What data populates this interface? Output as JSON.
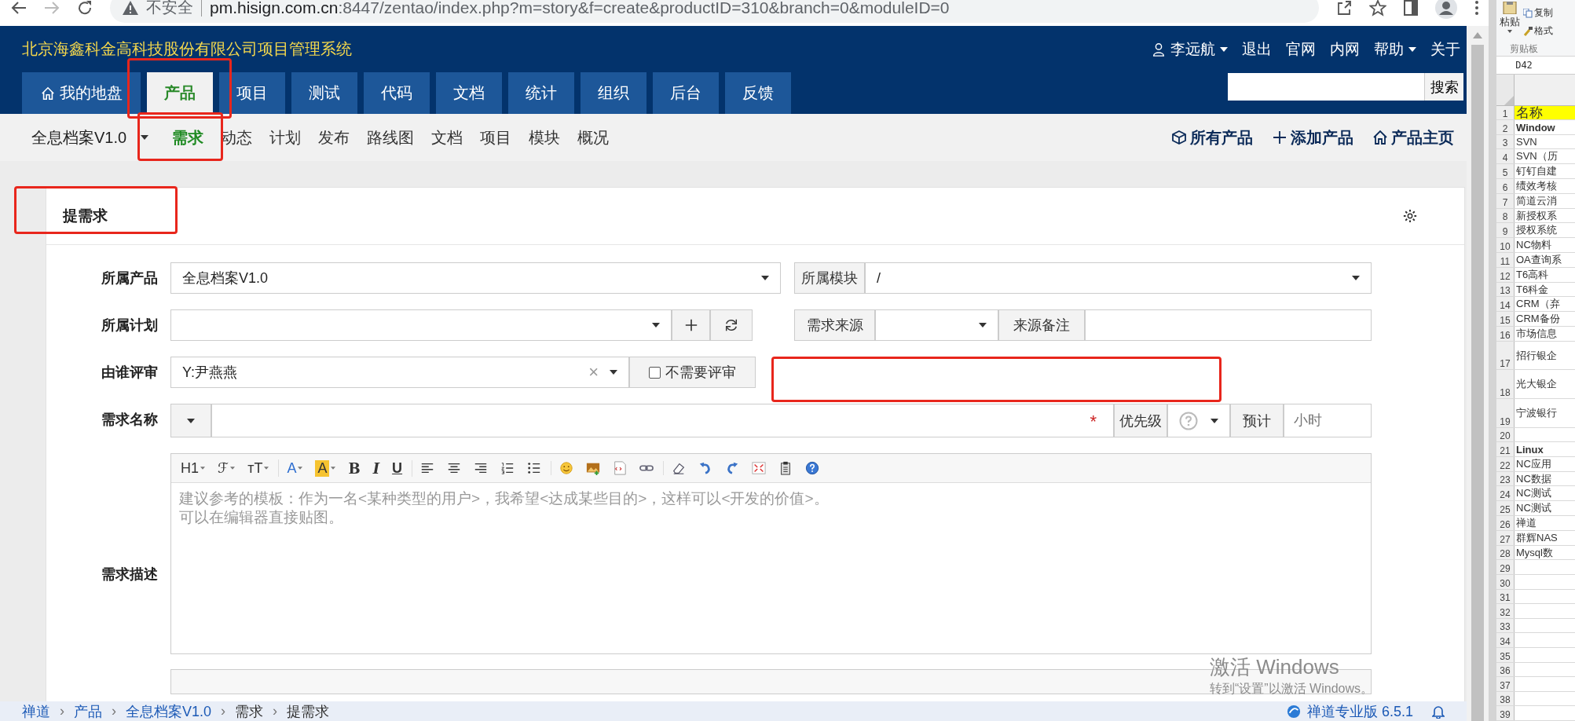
{
  "browser": {
    "security": "不安全",
    "url_host": "pm.hisign.com.cn",
    "url_rest": ":8447/zentao/index.php?m=story&f=create&productID=310&branch=0&moduleID=0"
  },
  "header": {
    "title": "北京海鑫科金高科技股份有限公司项目管理系统",
    "user": {
      "label": "李远航",
      "dropdown": true
    },
    "links": [
      {
        "label": "退出",
        "dropdown": false
      },
      {
        "label": "官网",
        "dropdown": false
      },
      {
        "label": "内网",
        "dropdown": false
      },
      {
        "label": "帮助",
        "dropdown": true
      },
      {
        "label": "关于",
        "dropdown": false
      }
    ],
    "search": {
      "button": "搜索"
    }
  },
  "nav": [
    {
      "label": "我的地盘",
      "selected": false
    },
    {
      "label": "产品",
      "selected": true
    },
    {
      "label": "项目",
      "selected": false
    },
    {
      "label": "测试",
      "selected": false
    },
    {
      "label": "代码",
      "selected": false
    },
    {
      "label": "文档",
      "selected": false
    },
    {
      "label": "统计",
      "selected": false
    },
    {
      "label": "组织",
      "selected": false
    },
    {
      "label": "后台",
      "selected": false
    },
    {
      "label": "反馈",
      "selected": false
    }
  ],
  "subnav": {
    "product": "全息档案V1.0",
    "items": [
      {
        "label": "需求",
        "selected": true
      },
      {
        "label": "动态",
        "selected": false
      },
      {
        "label": "计划",
        "selected": false
      },
      {
        "label": "发布",
        "selected": false
      },
      {
        "label": "路线图",
        "selected": false
      },
      {
        "label": "文档",
        "selected": false
      },
      {
        "label": "项目",
        "selected": false
      },
      {
        "label": "模块",
        "selected": false
      },
      {
        "label": "概况",
        "selected": false
      }
    ],
    "actions": [
      {
        "label": "所有产品"
      },
      {
        "label": "添加产品"
      },
      {
        "label": "产品主页"
      }
    ]
  },
  "panel": {
    "title": "提需求"
  },
  "form": {
    "product": {
      "label": "所属产品",
      "value": "全息档案V1.0"
    },
    "module": {
      "label": "所属模块",
      "value": "/"
    },
    "plan": {
      "label": "所属计划"
    },
    "source": {
      "label": "需求来源"
    },
    "source_note": {
      "label": "来源备注"
    },
    "reviewer": {
      "label": "由谁评审",
      "value": "Y:尹燕燕",
      "clear": "×"
    },
    "no_review": {
      "label": "不需要评审",
      "checked": false
    },
    "title": {
      "label": "需求名称",
      "required": "*"
    },
    "priority": {
      "label": "优先级"
    },
    "estimate": {
      "label": "预计",
      "placeholder": "小时"
    },
    "description": {
      "label": "需求描述",
      "placeholder": "建议参考的模板：作为一名<某种类型的用户>，我希望<达成某些目的>，这样可以<开发的价值>。可以在编辑器直接贴图。",
      "toolbar": [
        [
          {
            "kind": "heading",
            "label": "H1"
          },
          {
            "kind": "font",
            "label": "ℱ"
          },
          {
            "kind": "size",
            "label": "ᴛT"
          }
        ],
        [
          {
            "kind": "color",
            "label": "A"
          },
          {
            "kind": "highlight",
            "label": "A"
          },
          {
            "kind": "bold",
            "label": "B"
          },
          {
            "kind": "italic",
            "label": "I"
          },
          {
            "kind": "underline",
            "label": "U"
          }
        ],
        [
          {
            "kind": "align-left"
          },
          {
            "kind": "align-center"
          },
          {
            "kind": "align-right"
          },
          {
            "kind": "ordered-list"
          },
          {
            "kind": "bullet-list"
          }
        ],
        [
          {
            "kind": "emoji"
          },
          {
            "kind": "image"
          },
          {
            "kind": "code"
          },
          {
            "kind": "link"
          }
        ],
        [
          {
            "kind": "eraser"
          },
          {
            "kind": "undo"
          },
          {
            "kind": "redo"
          },
          {
            "kind": "fullscreen"
          },
          {
            "kind": "paste"
          },
          {
            "kind": "help"
          }
        ]
      ]
    }
  },
  "footer": {
    "breadcrumbs": [
      {
        "label": "禅道",
        "link": true
      },
      {
        "label": "产品",
        "link": true
      },
      {
        "label": "全息档案V1.0",
        "link": true
      },
      {
        "label": "需求",
        "link": false
      },
      {
        "label": "提需求",
        "link": false
      }
    ],
    "separator": "›",
    "version": "禅道专业版 6.5.1"
  },
  "activation": {
    "title": "激活 Windows",
    "hint": "转到“设置”以激活 Windows。"
  },
  "excel": {
    "ribbon": {
      "paste": "粘贴",
      "copy": "复制",
      "format": "格式",
      "group": "剪贴板"
    },
    "name_box": "D42",
    "rows": [
      {
        "n": "1",
        "text": "名称",
        "kind": "title",
        "tall": false
      },
      {
        "n": "2",
        "text": "Window",
        "kind": "group",
        "tall": false
      },
      {
        "n": "3",
        "text": "SVN",
        "kind": "item",
        "tall": false
      },
      {
        "n": "4",
        "text": "SVN（历",
        "kind": "item",
        "tall": false
      },
      {
        "n": "5",
        "text": "钉钉自建",
        "kind": "item",
        "tall": false
      },
      {
        "n": "6",
        "text": "绩效考核",
        "kind": "item",
        "tall": false
      },
      {
        "n": "7",
        "text": "简道云消",
        "kind": "item",
        "tall": false
      },
      {
        "n": "8",
        "text": "新授权系",
        "kind": "item",
        "tall": false
      },
      {
        "n": "9",
        "text": "授权系统",
        "kind": "item",
        "tall": false
      },
      {
        "n": "10",
        "text": "NC物料",
        "kind": "item",
        "tall": false
      },
      {
        "n": "11",
        "text": "OA查询系",
        "kind": "item",
        "tall": false
      },
      {
        "n": "12",
        "text": "T6高科",
        "kind": "item",
        "tall": false
      },
      {
        "n": "13",
        "text": "T6科金",
        "kind": "item",
        "tall": false
      },
      {
        "n": "14",
        "text": "CRM（弃",
        "kind": "item",
        "tall": false
      },
      {
        "n": "15",
        "text": "CRM备份",
        "kind": "item",
        "tall": false
      },
      {
        "n": "16",
        "text": "市场信息",
        "kind": "item",
        "tall": false
      },
      {
        "n": "17",
        "text": "招行银企",
        "kind": "item",
        "tall": true
      },
      {
        "n": "18",
        "text": "光大银企",
        "kind": "item",
        "tall": true
      },
      {
        "n": "19",
        "text": "宁波银行",
        "kind": "item",
        "tall": true
      },
      {
        "n": "20",
        "kind": "item",
        "tall": false
      },
      {
        "n": "21",
        "text": "Linux",
        "kind": "group",
        "tall": false
      },
      {
        "n": "22",
        "text": "NC应用",
        "kind": "item",
        "tall": false
      },
      {
        "n": "23",
        "text": "NC数据",
        "kind": "item",
        "tall": false
      },
      {
        "n": "24",
        "text": "NC测试",
        "kind": "item",
        "tall": false
      },
      {
        "n": "25",
        "text": "NC测试",
        "kind": "item",
        "tall": false
      },
      {
        "n": "26",
        "text": "禅道",
        "kind": "item",
        "tall": false
      },
      {
        "n": "27",
        "text": "群辉NAS",
        "kind": "item",
        "tall": false
      },
      {
        "n": "28",
        "text": "Mysql数",
        "kind": "item",
        "tall": false
      },
      {
        "n": "29",
        "kind": "item",
        "tall": false
      },
      {
        "n": "30",
        "kind": "item",
        "tall": false
      },
      {
        "n": "31",
        "kind": "item",
        "tall": false
      },
      {
        "n": "32",
        "kind": "item",
        "tall": false
      },
      {
        "n": "33",
        "kind": "item",
        "tall": false
      },
      {
        "n": "34",
        "kind": "item",
        "tall": false
      },
      {
        "n": "35",
        "kind": "item",
        "tall": false
      },
      {
        "n": "36",
        "kind": "item",
        "tall": false
      },
      {
        "n": "37",
        "kind": "item",
        "tall": false
      },
      {
        "n": "38",
        "kind": "item",
        "tall": false
      },
      {
        "n": "39",
        "kind": "item",
        "tall": false
      }
    ]
  }
}
